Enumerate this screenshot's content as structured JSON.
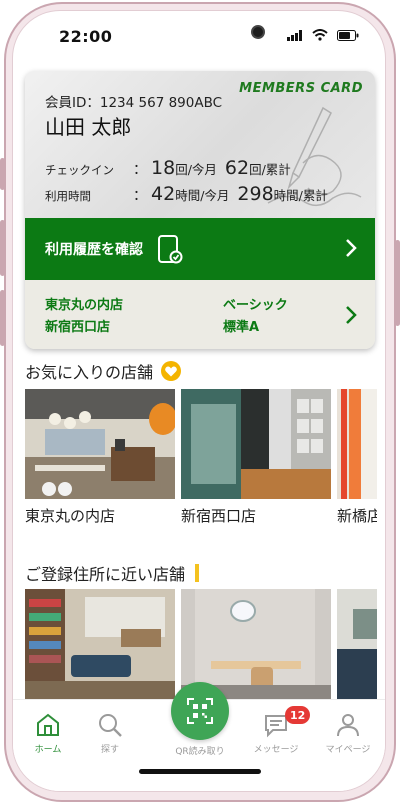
{
  "status_bar": {
    "time": "22:00"
  },
  "card": {
    "brand_label": "MEMBERS CARD",
    "member_id": "会員ID：1234 567 890ABC",
    "member_name": "山田 太郎",
    "checkin": {
      "label": "チェックイン",
      "colon": "：",
      "month_value": "18",
      "month_unit": "回/今月",
      "total_value": "62",
      "total_unit": "回/累計"
    },
    "usage": {
      "label": "利用時間",
      "colon": "：",
      "month_value": "42",
      "month_unit": "時間/今月",
      "total_value": "298",
      "total_unit": "時間/累計"
    },
    "history_button_label": "利用履歴を確認",
    "stores": [
      "東京丸の内店",
      "新宿西口店"
    ],
    "plans": [
      "ベーシック",
      "標準A"
    ]
  },
  "favorites": {
    "title": "お気に入りの店舗",
    "stores": [
      {
        "name": "東京丸の内店"
      },
      {
        "name": "新宿西口店"
      },
      {
        "name": "新橋店"
      }
    ]
  },
  "nearby": {
    "title": "ご登録住所に近い店舗"
  },
  "tabs": [
    {
      "label": "ホーム",
      "icon": "home-icon",
      "active": true
    },
    {
      "label": "探す",
      "icon": "search-icon",
      "active": false
    },
    {
      "label": "QR読み取り",
      "icon": "qr-code-icon",
      "active": false
    },
    {
      "label": "メッセージ",
      "icon": "message-icon",
      "active": false,
      "badge": "12"
    },
    {
      "label": "マイページ",
      "icon": "user-icon",
      "active": false
    }
  ],
  "colors": {
    "brand_green": "#0c7a14",
    "tab_active": "#2f8f3a",
    "badge_red": "#e53935",
    "accent_yellow": "#f4b400"
  }
}
